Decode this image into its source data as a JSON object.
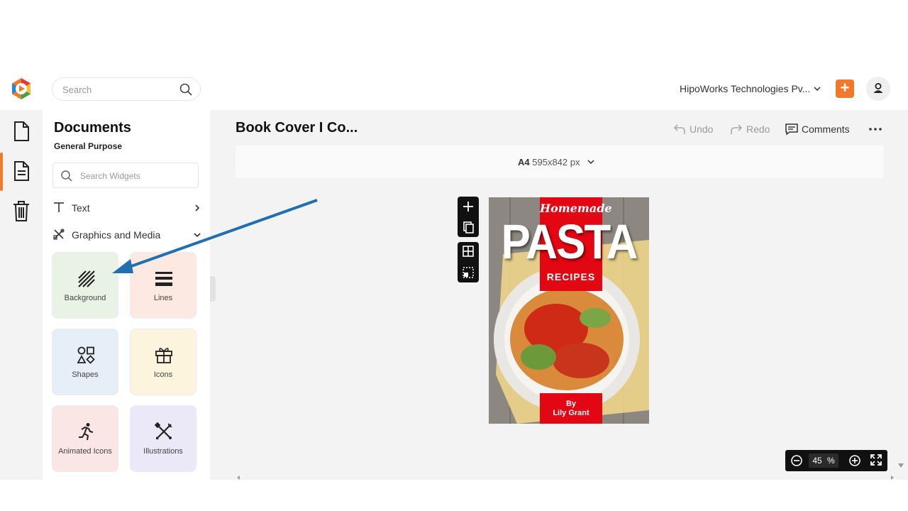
{
  "header": {
    "search_placeholder": "Search",
    "org_name": "HipoWorks Technologies Pv...",
    "add_label": "+"
  },
  "panel": {
    "title": "Documents",
    "subtitle": "General Purpose",
    "widget_search_placeholder": "Search Widgets",
    "categories": [
      {
        "label": "Text",
        "icon": "text-icon",
        "state": "collapsed"
      },
      {
        "label": "Graphics and Media",
        "icon": "graphics-icon",
        "state": "expanded"
      }
    ],
    "tiles": [
      {
        "label": "Background",
        "icon": "background-hatch-icon",
        "color": "#e8f3e6"
      },
      {
        "label": "Lines",
        "icon": "lines-icon",
        "color": "#fbe9e2"
      },
      {
        "label": "Shapes",
        "icon": "shapes-icon",
        "color": "#e6eef8"
      },
      {
        "label": "Icons",
        "icon": "gift-icon",
        "color": "#fdf4dd"
      },
      {
        "label": "Animated Icons",
        "icon": "running-figure-icon",
        "color": "#fbe6e6"
      },
      {
        "label": "Illustrations",
        "icon": "illustration-tools-icon",
        "color": "#ebe9f8"
      }
    ]
  },
  "main": {
    "doc_title": "Book Cover I Co...",
    "undo_label": "Undo",
    "redo_label": "Redo",
    "comments_label": "Comments",
    "page_size_name": "A4",
    "page_size_dims": "595x842 px",
    "zoom_value": "45",
    "zoom_unit": "%"
  },
  "cover": {
    "script_title": "Homemade",
    "main_title": "PASTA",
    "banner_text": "RECIPES",
    "by_label": "By",
    "author": "Lily Grant"
  },
  "colors": {
    "accent": "#f07a2a",
    "cover_red": "#e30613",
    "arrow_blue": "#1e6fb3"
  }
}
